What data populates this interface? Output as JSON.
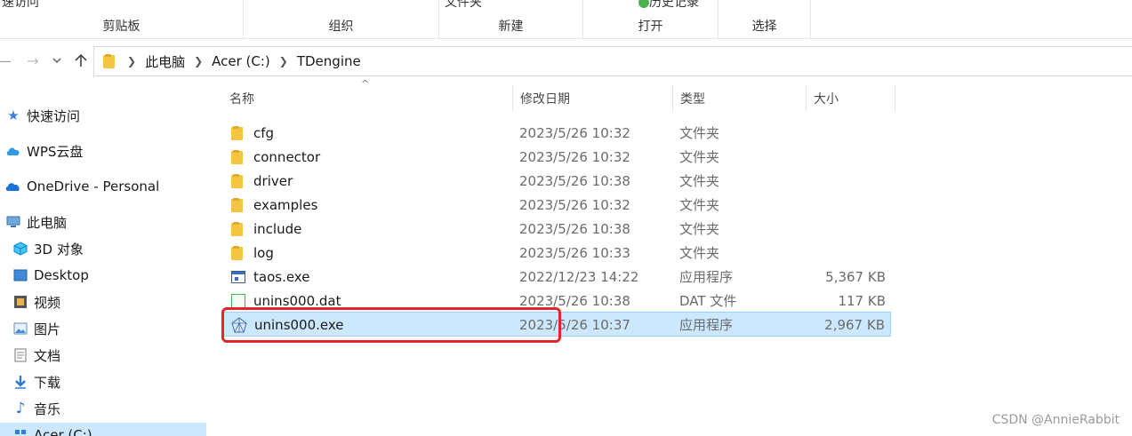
{
  "ribbon": {
    "groups": [
      {
        "label": "剪贴板",
        "top": "速访问"
      },
      {
        "label": "组织",
        "top": ""
      },
      {
        "label": "新建",
        "top": "文件夹"
      },
      {
        "label": "打开",
        "top": "历史记录"
      },
      {
        "label": "选择",
        "top": ""
      }
    ]
  },
  "address": {
    "crumbs": [
      "此电脑",
      "Acer (C:)",
      "TDengine"
    ]
  },
  "sidebar": {
    "items": [
      {
        "label": "快速访问",
        "icon": "star-icon"
      },
      {
        "label": "WPS云盘",
        "icon": "cloud-icon"
      },
      {
        "label": "OneDrive - Personal",
        "icon": "onedrive-icon"
      },
      {
        "label": "此电脑",
        "icon": "computer-icon"
      },
      {
        "label": "3D 对象",
        "icon": "cube-icon"
      },
      {
        "label": "Desktop",
        "icon": "desktop-icon"
      },
      {
        "label": "视频",
        "icon": "video-icon"
      },
      {
        "label": "图片",
        "icon": "picture-icon"
      },
      {
        "label": "文档",
        "icon": "document-icon"
      },
      {
        "label": "下载",
        "icon": "download-icon"
      },
      {
        "label": "音乐",
        "icon": "music-icon"
      },
      {
        "label": "Acer (C:)",
        "icon": "drive-icon"
      }
    ]
  },
  "columns": {
    "name": "名称",
    "date": "修改日期",
    "type": "类型",
    "size": "大小"
  },
  "files": [
    {
      "name": "cfg",
      "date": "2023/5/26 10:32",
      "type": "文件夹",
      "size": "",
      "icon": "folder-icon"
    },
    {
      "name": "connector",
      "date": "2023/5/26 10:32",
      "type": "文件夹",
      "size": "",
      "icon": "folder-icon"
    },
    {
      "name": "driver",
      "date": "2023/5/26 10:38",
      "type": "文件夹",
      "size": "",
      "icon": "folder-icon"
    },
    {
      "name": "examples",
      "date": "2023/5/26 10:32",
      "type": "文件夹",
      "size": "",
      "icon": "folder-icon"
    },
    {
      "name": "include",
      "date": "2023/5/26 10:38",
      "type": "文件夹",
      "size": "",
      "icon": "folder-icon"
    },
    {
      "name": "log",
      "date": "2023/5/26 10:33",
      "type": "文件夹",
      "size": "",
      "icon": "folder-icon"
    },
    {
      "name": "taos.exe",
      "date": "2022/12/23 14:22",
      "type": "应用程序",
      "size": "5,367 KB",
      "icon": "exe-icon"
    },
    {
      "name": "unins000.dat",
      "date": "2023/5/26 10:38",
      "type": "DAT 文件",
      "size": "117 KB",
      "icon": "dat-icon"
    },
    {
      "name": "unins000.exe",
      "date": "2023/5/26 10:37",
      "type": "应用程序",
      "size": "2,967 KB",
      "icon": "setup-icon"
    }
  ],
  "watermark": "CSDN @AnnieRabbit",
  "colors": {
    "selection": "#cce8ff",
    "highlight": "#e4262a",
    "folder": "#f4c542"
  }
}
